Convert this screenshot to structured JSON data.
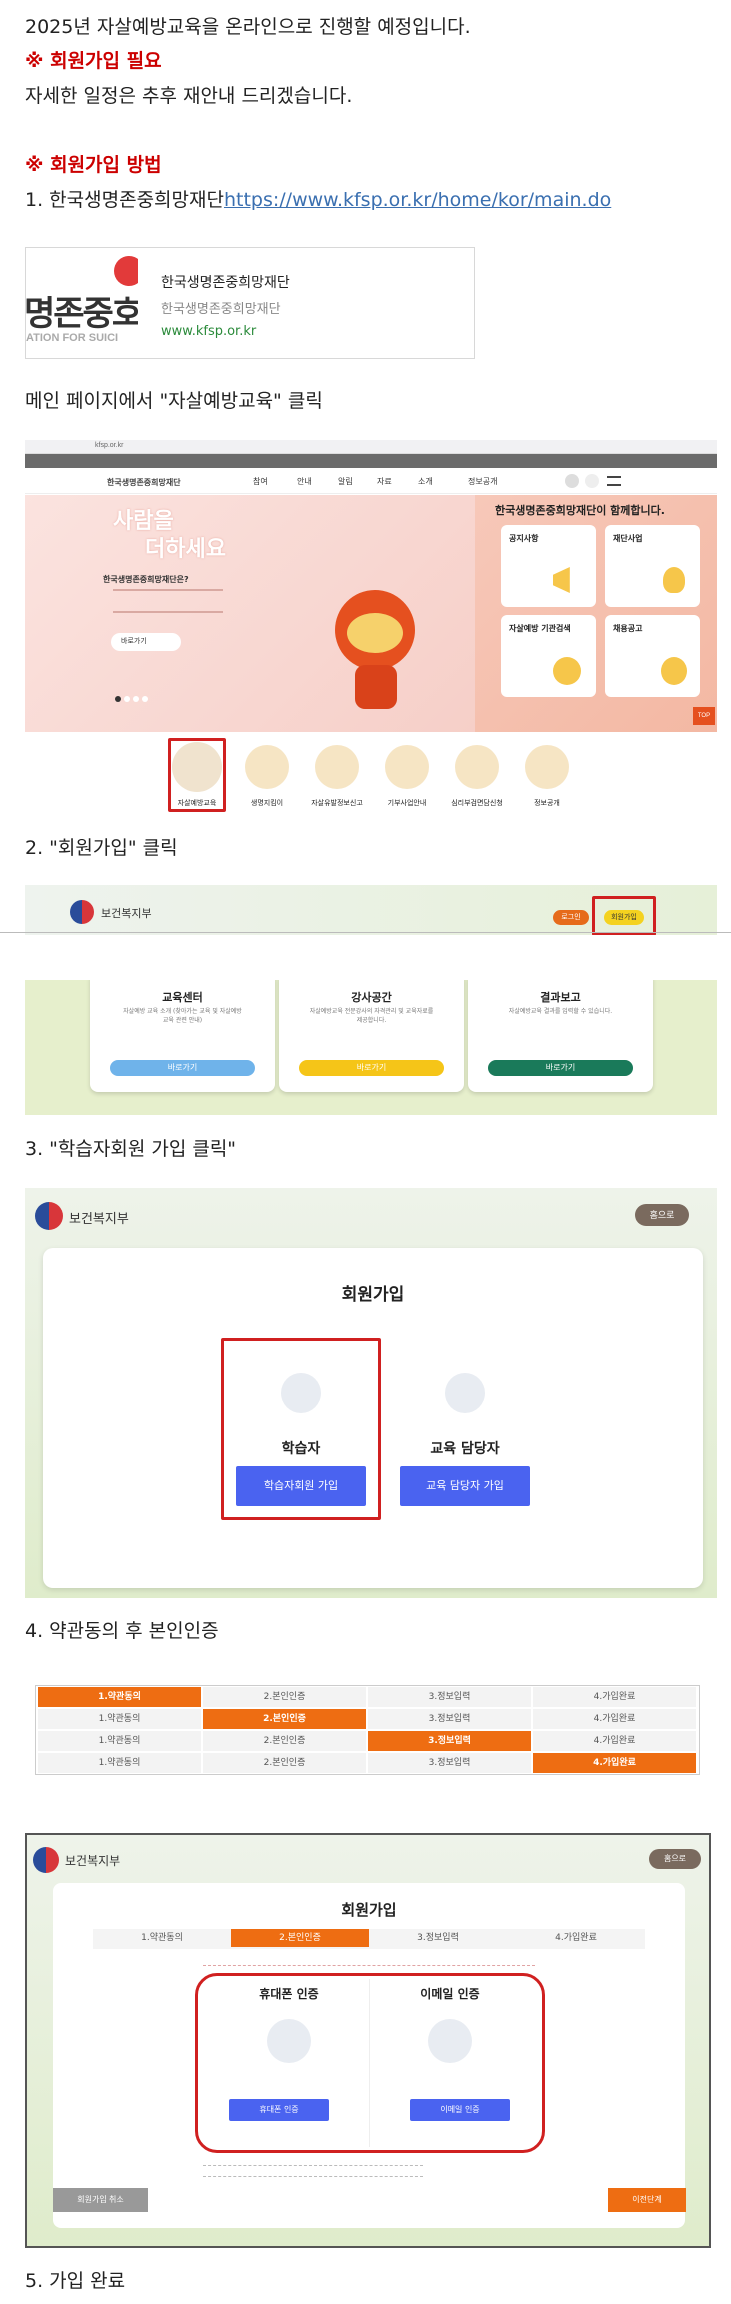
{
  "intro": {
    "line1": "2025년 자살예방교육을 온라인으로 진행할 예정입니다.",
    "line2": "※ 회원가입 필요",
    "line3": "자세한 일정은 추후 재안내 드리겠습니다.",
    "line4": "※ 회원가입 방법",
    "step1_prefix": "1. 한국생명존중희망재단",
    "step1_link": "https://www.kfsp.or.kr/home/kor/main.do"
  },
  "link_card": {
    "logo_text": "명존중호",
    "logo_sub": "ATION FOR SUICI",
    "title": "한국생명존중희망재단",
    "subtitle": "한국생명존중희망재단",
    "url": "www.kfsp.or.kr"
  },
  "step1_caption": "메인 페이지에서 \"자살예방교육\" 클릭",
  "shot1": {
    "address": "kfsp.or.kr",
    "site_logo": "한국생명존중희망재단",
    "nav": [
      "참여",
      "안내",
      "알림",
      "자료",
      "소개",
      "정보공개"
    ],
    "hero_line1": "사람을",
    "hero_line2": "더하세요",
    "hero_q": "한국생명존중희망재단은?",
    "hero_more": "바로가기",
    "right_title": "한국생명존중희망재단이 함께합니다.",
    "cards": [
      "공지사항",
      "재단사업",
      "자살예방 기관검색",
      "채용공고"
    ],
    "icons": [
      "자살예방교육",
      "생명지킴이",
      "자살유발정보신고",
      "기부사업안내",
      "심리부검면담신청",
      "정보공개"
    ],
    "top": "TOP"
  },
  "step2_caption": "2. \"회원가입\" 클릭",
  "shot2": {
    "ministry": "보건복지부",
    "login": "로그인",
    "join": "회원가입",
    "cols": [
      {
        "title": "교육센터",
        "desc": "자살예방 교육 소개 (찾아가는 교육 및 자살예방 교육 관련 안내)",
        "btn": "바로가기"
      },
      {
        "title": "강사공간",
        "desc": "자살예방교육 전문강사의 자격관리 및 교육자료를 제공합니다.",
        "btn": "바로가기"
      },
      {
        "title": "결과보고",
        "desc": "자살예방교육 결과를 입력할 수 있습니다.",
        "btn": "바로가기"
      }
    ]
  },
  "step3_caption": "3. \"학습자회원 가입 클릭\"",
  "shot3": {
    "ministry": "보건복지부",
    "home": "홈으로",
    "title": "회원가입",
    "learner": "학습자",
    "learner_btn": "학습자회원 가입",
    "manager": "교육 담당자",
    "manager_btn": "교육 담당자 가입"
  },
  "step4_caption": "4. 약관동의 후 본인인증",
  "steps_rows": [
    "1.약관동의",
    "2.본인인증",
    "3.정보입력",
    "4.가입완료"
  ],
  "shot5": {
    "ministry": "보건복지부",
    "home": "홈으로",
    "title": "회원가입",
    "steps": [
      "1.약관동의",
      "2.본인인증",
      "3.정보입력",
      "4.가입완료"
    ],
    "phone": "휴대폰 인증",
    "phone_btn": "휴대폰 인증",
    "email": "이메일 인증",
    "email_btn": "이메일 인증",
    "cancel": "회원가입 취소",
    "next": "이전단계"
  },
  "step5_caption": "5. 가입 완료",
  "colors": {
    "accent_red": "#cc0000",
    "link": "#3a6fb0",
    "orange": "#ee6d12",
    "blue_btn": "#4a63f0"
  }
}
